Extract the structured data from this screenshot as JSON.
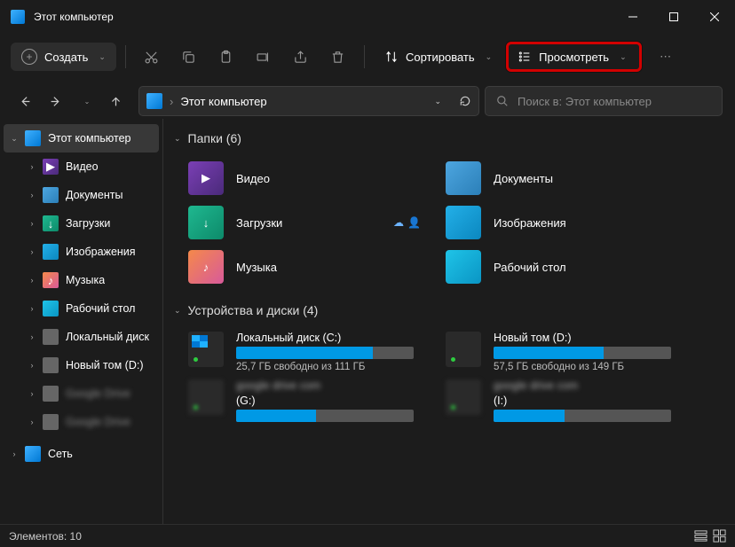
{
  "titlebar": {
    "title": "Этот компьютер"
  },
  "toolbar": {
    "create": "Создать",
    "sort": "Сортировать",
    "view": "Просмотреть"
  },
  "nav": {
    "location": "Этот компьютер",
    "search_placeholder": "Поиск в: Этот компьютер"
  },
  "sidebar": {
    "root": "Этот компьютер",
    "items": [
      {
        "label": "Видео"
      },
      {
        "label": "Документы"
      },
      {
        "label": "Загрузки"
      },
      {
        "label": "Изображения"
      },
      {
        "label": "Музыка"
      },
      {
        "label": "Рабочий стол"
      },
      {
        "label": "Локальный диск"
      },
      {
        "label": "Новый том (D:)"
      }
    ],
    "network": "Сеть"
  },
  "content": {
    "folders_hdr": "Папки (6)",
    "drives_hdr": "Устройства и диски (4)",
    "folders": [
      {
        "label": "Видео"
      },
      {
        "label": "Документы"
      },
      {
        "label": "Загрузки"
      },
      {
        "label": "Изображения"
      },
      {
        "label": "Музыка"
      },
      {
        "label": "Рабочий стол"
      }
    ],
    "drives": [
      {
        "name": "Локальный диск (C:)",
        "sub": "25,7 ГБ свободно из 111 ГБ",
        "fill": 77
      },
      {
        "name": "Новый том (D:)",
        "sub": "57,5 ГБ свободно из 149 ГБ",
        "fill": 62
      },
      {
        "name": "(G:)",
        "fill": 45
      },
      {
        "name": "(I:)",
        "fill": 40
      }
    ]
  },
  "status": {
    "count": "Элементов: 10"
  }
}
